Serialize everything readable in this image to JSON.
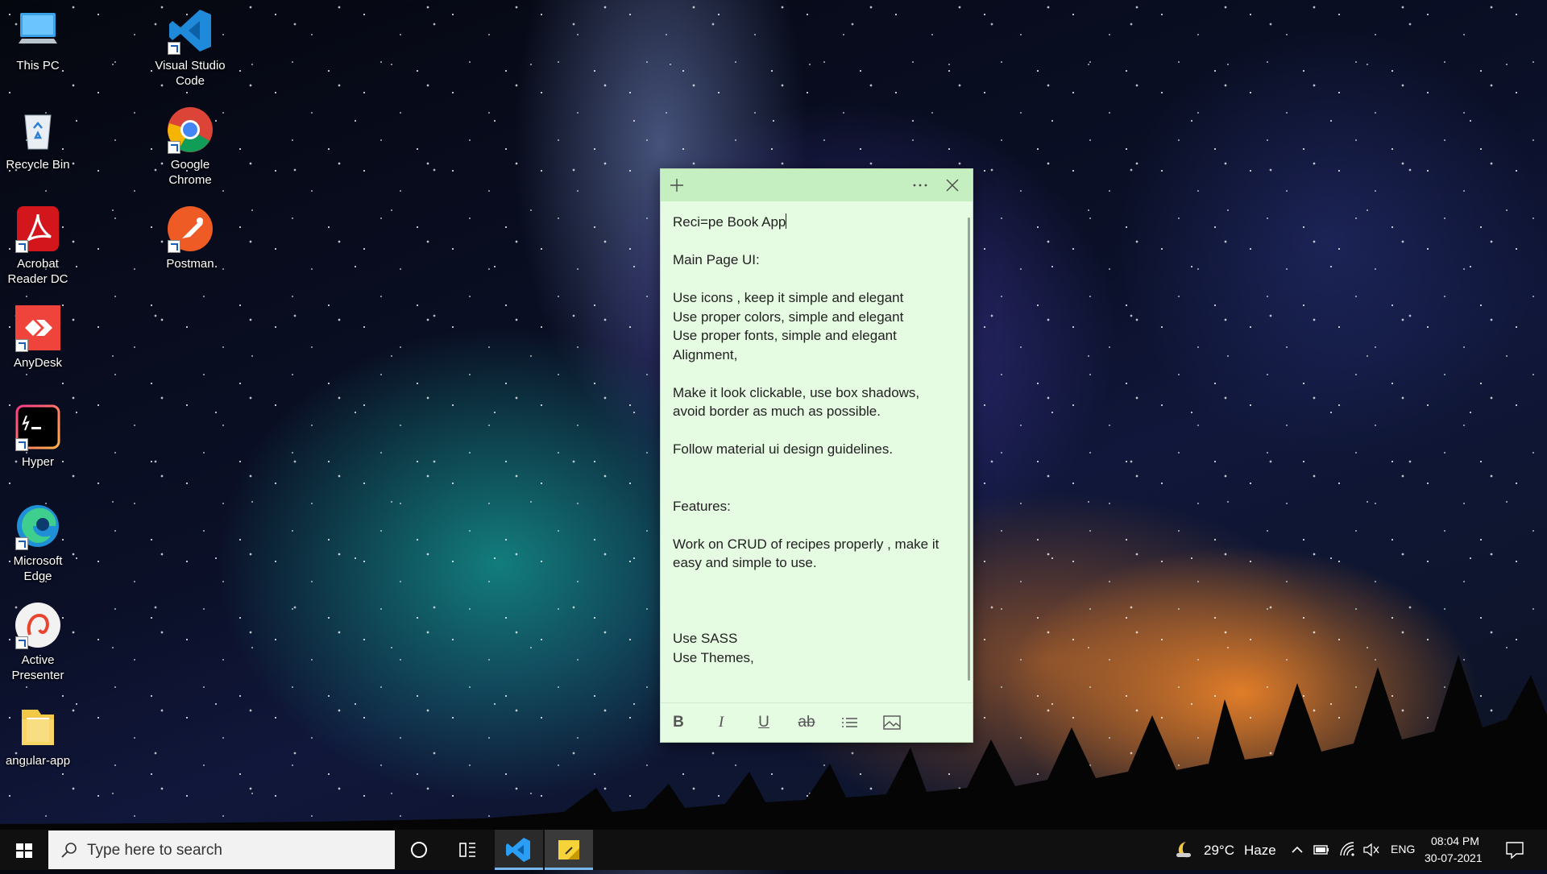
{
  "desktop": {
    "icons": [
      {
        "label_line1": "This PC",
        "label_line2": "",
        "icon": "this-pc-icon"
      },
      {
        "label_line1": "Recycle Bin",
        "label_line2": "",
        "icon": "recycle-bin-icon"
      },
      {
        "label_line1": "Acrobat",
        "label_line2": "Reader DC",
        "icon": "acrobat-reader-icon"
      },
      {
        "label_line1": "AnyDesk",
        "label_line2": "",
        "icon": "anydesk-icon"
      },
      {
        "label_line1": "Hyper",
        "label_line2": "",
        "icon": "hyper-terminal-icon"
      },
      {
        "label_line1": "Microsoft",
        "label_line2": "Edge",
        "icon": "edge-icon"
      },
      {
        "label_line1": "Active",
        "label_line2": "Presenter",
        "icon": "active-presenter-icon"
      },
      {
        "label_line1": "angular-app",
        "label_line2": "",
        "icon": "folder-icon"
      },
      {
        "label_line1": "Visual Studio",
        "label_line2": "Code",
        "icon": "vscode-icon"
      },
      {
        "label_line1": "Google",
        "label_line2": "Chrome",
        "icon": "chrome-icon"
      },
      {
        "label_line1": "Postman",
        "label_line2": "",
        "icon": "postman-icon"
      }
    ]
  },
  "sticky_note": {
    "lines": [
      "Reci=pe Book App",
      "",
      "Main Page UI:",
      "",
      "Use icons , keep it simple and elegant",
      "Use proper colors, simple and elegant",
      "Use proper fonts, simple and elegant",
      "Alignment,",
      "",
      "Make it look clickable, use box shadows,",
      "avoid border as much as possible.",
      "",
      "Follow material ui design guidelines.",
      "",
      "",
      "Features:",
      "",
      "Work on CRUD of recipes properly , make it",
      "easy and simple to use.",
      "",
      "",
      "",
      "Use SASS",
      "Use Themes,"
    ],
    "header_colors": {
      "header": "#c6efc1",
      "body": "#e5fbe2"
    },
    "toolbar": {
      "bold": "B",
      "italic": "I",
      "underline": "U",
      "strikethrough": "ab"
    }
  },
  "taskbar": {
    "search_placeholder": "Type here to search",
    "weather_temp": "29°C",
    "weather_desc": "Haze",
    "language": "ENG",
    "time": "08:04 PM",
    "date": "30-07-2021"
  }
}
